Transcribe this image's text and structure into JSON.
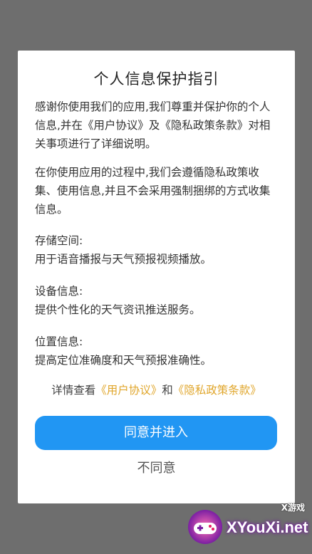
{
  "dialog": {
    "title": "个人信息保护指引",
    "paragraph1": "感谢你使用我们的应用,我们尊重并保护你的个人信息,并在《用户协议》及《隐私政策条款》对相关事项进行了详细说明。",
    "paragraph2": "在你使用应用的过程中,我们会遵循隐私政策收集、使用信息,并且不会采用强制捆绑的方式收集信息。",
    "storage_label": "存储空间:",
    "storage_desc": "用于语音播报与天气预报视频播放。",
    "device_label": "设备信息:",
    "device_desc": "提供个性化的天气资讯推送服务。",
    "location_label": "位置信息:",
    "location_desc": "提高定位准确度和天气预报准确性。",
    "links_prefix": "详情查看",
    "user_agreement_link": "《用户协议》",
    "links_and": "和",
    "privacy_link": "《隐私政策条款》",
    "agree_button": "同意并进入",
    "disagree_button": "不同意"
  },
  "watermark": {
    "site": "XYouXi.net",
    "small_text": "X游戏",
    "icon": "gamepad-logo-icon"
  },
  "colors": {
    "overlay": "#6e6e6e",
    "primary": "#2196f3",
    "link": "#e0a62b"
  }
}
